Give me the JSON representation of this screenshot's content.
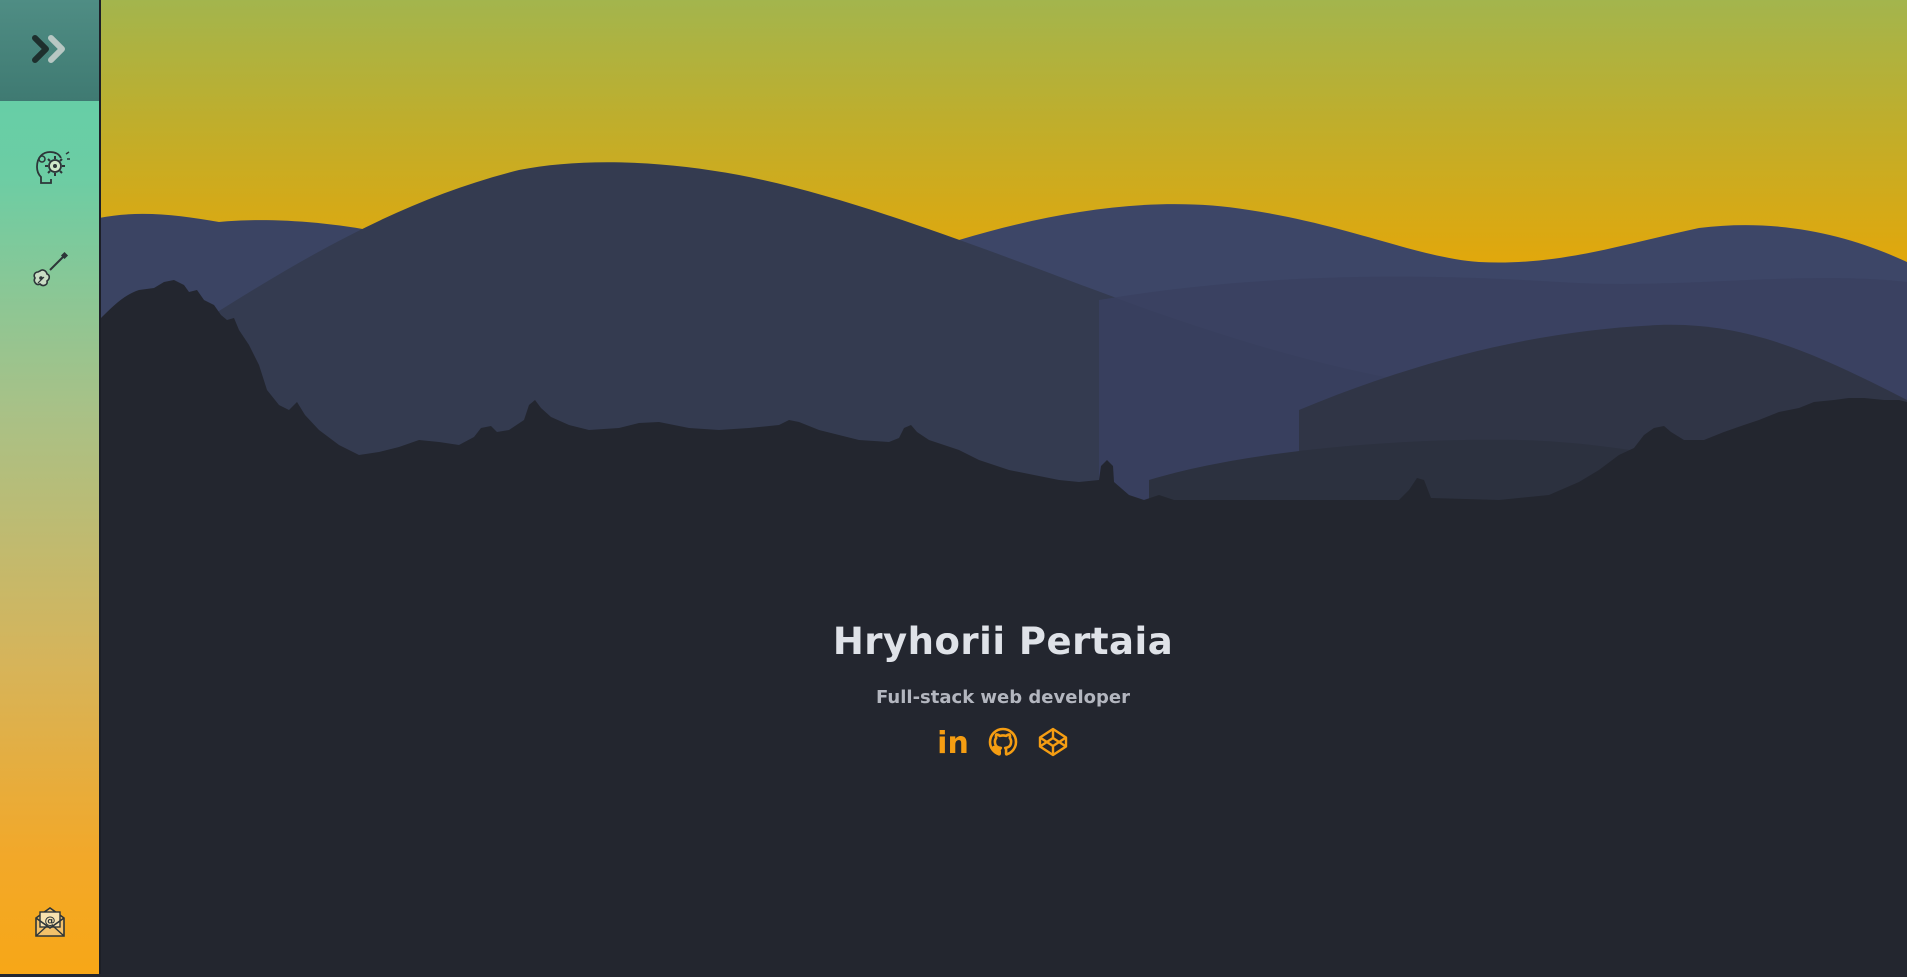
{
  "profile": {
    "name": "Hryhorii Pertaia",
    "role": "Full-stack web developer"
  },
  "socials": [
    {
      "icon": "linkedin-icon",
      "glyph": "in"
    },
    {
      "icon": "github-icon"
    },
    {
      "icon": "codepen-icon"
    }
  ],
  "sidebar": {
    "toggle_icon": "double-chevron-right-icon",
    "items": [
      {
        "icon": "gear-brain-icon"
      },
      {
        "icon": "guitar-icon"
      }
    ],
    "footer_icon": "email-envelope-icon"
  },
  "colors": {
    "accent": "#f59d12",
    "sky_top": "#9fb34a",
    "sky_bottom": "#e0a90e",
    "ground": "#23262f",
    "sidebar_top": "#5fcfa9",
    "sidebar_bottom": "#f7a717"
  }
}
